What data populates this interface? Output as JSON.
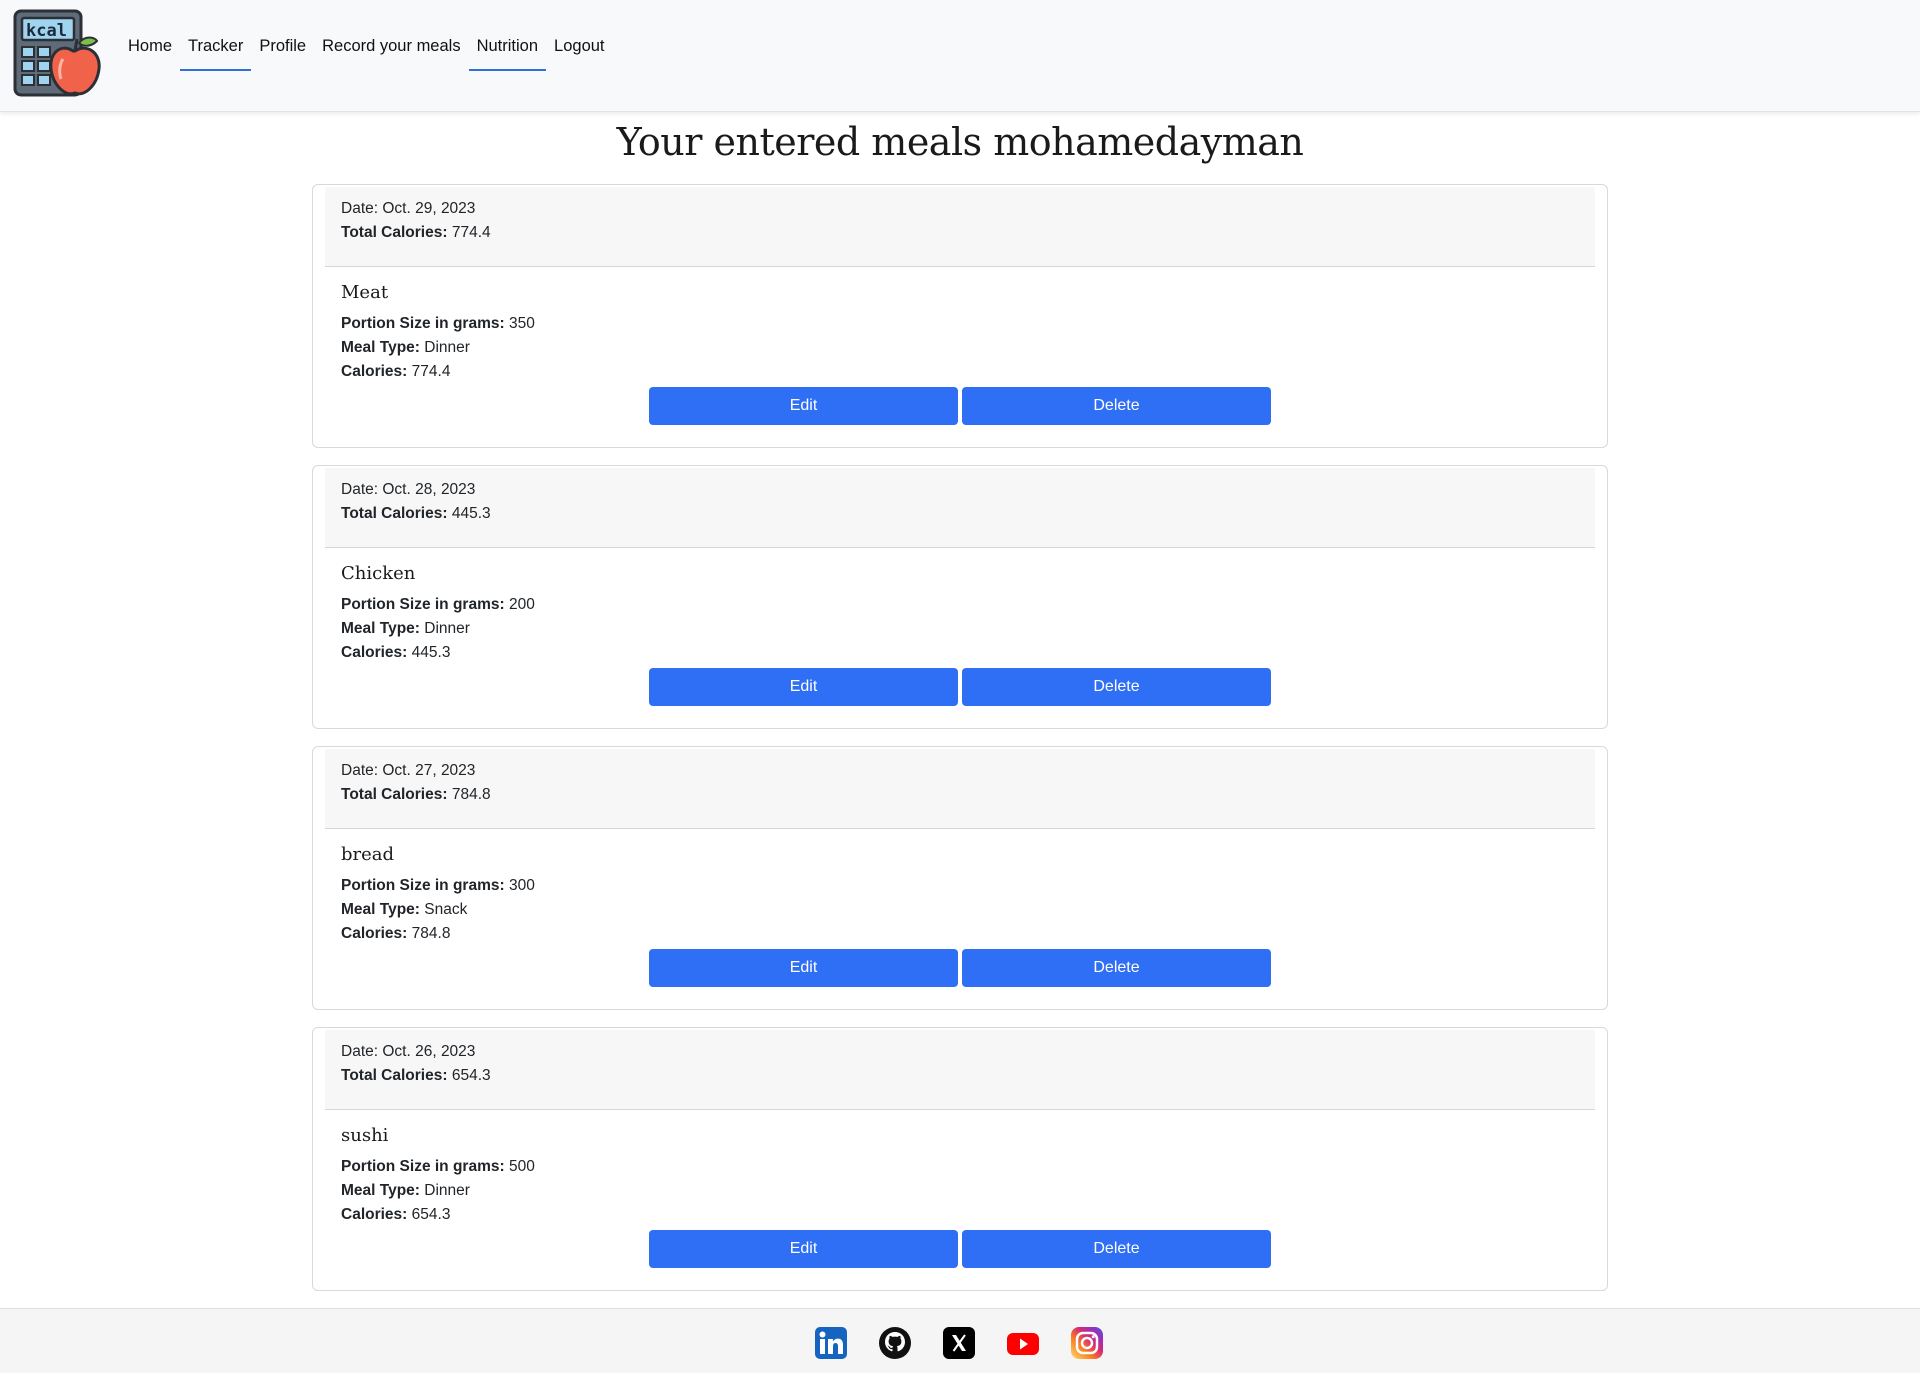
{
  "header": {
    "logo_text": "kcal",
    "nav": [
      {
        "label": "Home",
        "active": false
      },
      {
        "label": "Tracker",
        "active": true
      },
      {
        "label": "Profile",
        "active": false
      },
      {
        "label": "Record your meals",
        "active": false
      },
      {
        "label": "Nutrition",
        "active": true
      },
      {
        "label": "Logout",
        "active": false
      }
    ]
  },
  "page_title": "Your entered meals mohamedayman",
  "labels": {
    "date": "Date: ",
    "total_calories": "Total Calories:",
    "portion": "Portion Size in grams:",
    "meal_type": "Meal Type:",
    "calories": "Calories:",
    "edit": "Edit",
    "delete": "Delete"
  },
  "meals": [
    {
      "date": "Oct. 29, 2023",
      "total_calories": "774.4",
      "name": "Meat",
      "portion": "350",
      "meal_type": "Dinner",
      "calories": "774.4"
    },
    {
      "date": "Oct. 28, 2023",
      "total_calories": "445.3",
      "name": "Chicken",
      "portion": "200",
      "meal_type": "Dinner",
      "calories": "445.3"
    },
    {
      "date": "Oct. 27, 2023",
      "total_calories": "784.8",
      "name": "bread",
      "portion": "300",
      "meal_type": "Snack",
      "calories": "784.8"
    },
    {
      "date": "Oct. 26, 2023",
      "total_calories": "654.3",
      "name": "sushi",
      "portion": "500",
      "meal_type": "Dinner",
      "calories": "654.3"
    }
  ],
  "footer": {
    "social": [
      "linkedin-icon",
      "github-icon",
      "x-icon",
      "youtube-icon",
      "instagram-icon"
    ]
  },
  "colors": {
    "accent": "#2f6ff5",
    "active_underline": "#2f6fd6",
    "navbar_bg": "#f8f9fa",
    "card_header_bg": "#f7f7f7"
  }
}
